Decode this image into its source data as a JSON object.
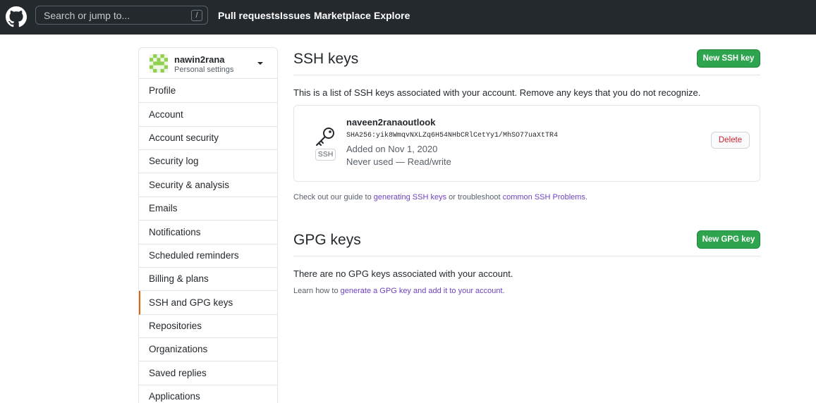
{
  "header": {
    "search_placeholder": "Search or jump to...",
    "slash_hint": "/",
    "nav": [
      "Pull requests",
      "Issues",
      "Marketplace",
      "Explore"
    ]
  },
  "sidebar": {
    "username": "nawin2rana",
    "subtitle": "Personal settings",
    "items": [
      {
        "label": "Profile"
      },
      {
        "label": "Account"
      },
      {
        "label": "Account security"
      },
      {
        "label": "Security log"
      },
      {
        "label": "Security & analysis"
      },
      {
        "label": "Emails"
      },
      {
        "label": "Notifications"
      },
      {
        "label": "Scheduled reminders"
      },
      {
        "label": "Billing & plans"
      },
      {
        "label": "SSH and GPG keys"
      },
      {
        "label": "Repositories"
      },
      {
        "label": "Organizations"
      },
      {
        "label": "Saved replies"
      },
      {
        "label": "Applications"
      }
    ],
    "selected": "SSH and GPG keys"
  },
  "ssh": {
    "title": "SSH keys",
    "new_button": "New SSH key",
    "intro": "This is a list of SSH keys associated with your account. Remove any keys that you do not recognize.",
    "key": {
      "type_label": "SSH",
      "name": "naveen2ranaoutlook",
      "fingerprint": "SHA256:yik8WmqvNXLZq6H54NHbCRlCetYy1/MhSO77uaXtTR4",
      "added": "Added on Nov 1, 2020",
      "usage": "Never used — Read/write",
      "delete_label": "Delete"
    },
    "guide": {
      "prefix": "Check out our guide to ",
      "link1": "generating SSH keys",
      "middle": " or troubleshoot ",
      "link2": "common SSH Problems",
      "suffix": "."
    }
  },
  "gpg": {
    "title": "GPG keys",
    "new_button": "New GPG key",
    "empty": "There are no GPG keys associated with your account.",
    "learn": {
      "prefix": "Learn how to ",
      "link": "generate a GPG key and add it to your account",
      "suffix": "."
    }
  },
  "colors": {
    "header_bg": "#24292e",
    "primary_green": "#2ea44f",
    "danger_red": "#cb2431",
    "link_purple": "#6f42c1",
    "selected_accent": "#e36209"
  }
}
